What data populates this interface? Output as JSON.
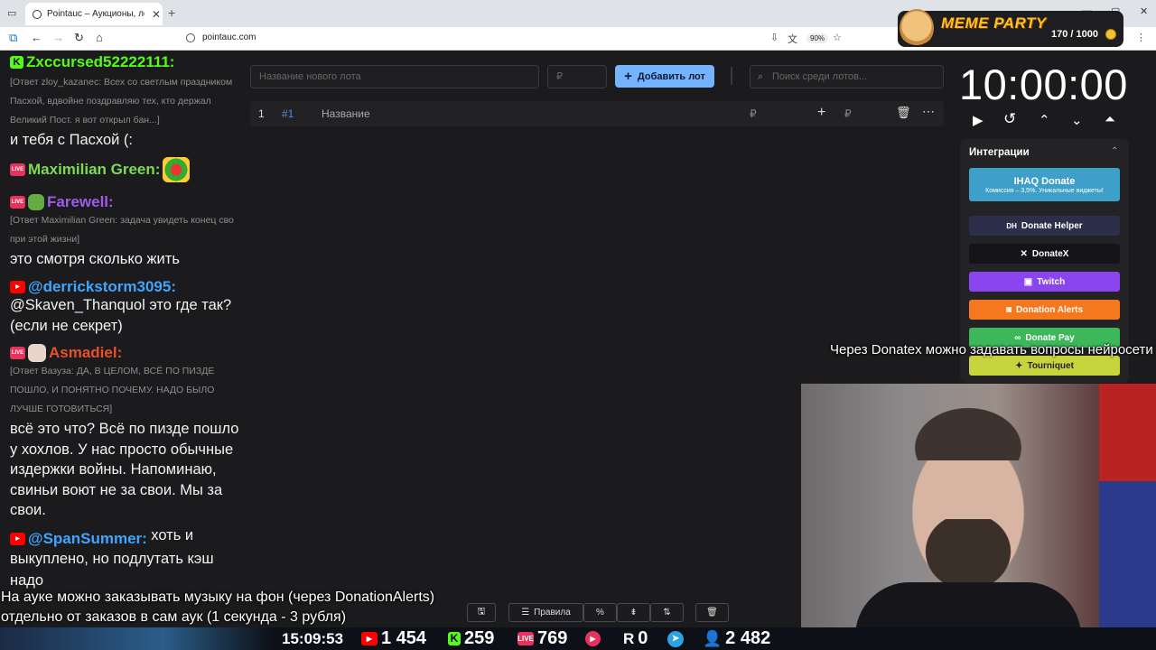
{
  "browser": {
    "tab_title": "Pointauc – Аукционы, лотереи",
    "url": "pointauc.com",
    "zoom": "90%"
  },
  "meme_party": {
    "title": "MEME PARTY",
    "count": "170 / 1000"
  },
  "chat": {
    "messages": [
      {
        "user": "Zxccursed52222111:",
        "user_color": "#53fc18",
        "platform": "kick"
      },
      {
        "reply": "[Ответ zloy_kazanec: Всех со светлым праздником Пасхой, вдвойне поздравляю тех, кто держал Великий Пост. я вот открыл бан...]",
        "text": "и тебя с Пасхой (:"
      },
      {
        "user": "Maximilian Green:",
        "user_color": "#7ed957",
        "platform": "live"
      },
      {
        "user": "Farewell:",
        "user_color": "#a05ce6",
        "platform": "live",
        "reply": "[Ответ Maximilian Green: задача увидеть конец сво при этой жизни]",
        "text": "это смотря сколько жить"
      },
      {
        "user": "@derrickstorm3095:",
        "user_color": "#3ea6ff",
        "platform": "youtube",
        "text": "@Skaven_Thanquol это где так? (если не секрет)"
      },
      {
        "user": "Asmadiel:",
        "user_color": "#e8502a",
        "platform": "live",
        "reply": "[Ответ Вазуза: ДА, В ЦЕЛОМ, ВСЁ ПО ПИЗДЕ ПОШЛО, И ПОНЯТНО ПОЧЕМУ. НАДО БЫЛО ЛУЧШЕ ГОТОВИТЬСЯ]",
        "text": "всё это что? Всё по пизде пошло у хохлов. У нас просто обычные издержки войны. Напоминаю, свиньи воют не за свои. Мы за свои."
      },
      {
        "user": "@SpanSummer:",
        "user_color": "#3ea6ff",
        "platform": "youtube",
        "text": "хоть и выкуплено, но подлутать кэш надо"
      }
    ]
  },
  "auction": {
    "lot_name_placeholder": "Название нового лота",
    "amount_placeholder": "₽",
    "add_button": "Добавить лот",
    "search_placeholder": "Поиск среди лотов...",
    "lot": {
      "index": "1",
      "id": "#1",
      "name": "Название",
      "amount_placeholder": "₽"
    },
    "toolbar": {
      "rules": "Правила"
    }
  },
  "timer": {
    "value": "10:00:00"
  },
  "integrations": {
    "title": "Интеграции",
    "items": [
      {
        "label": "IHAQ Donate",
        "sub": "Комиссия – 3,5%. Уникальные виджеты!",
        "color": "#3ea0c8"
      },
      {
        "label": "Donate Helper",
        "color": "#2b2f4a"
      },
      {
        "label": "DonateX",
        "color": "#141418"
      },
      {
        "label": "Twitch",
        "color": "#8b45f0"
      },
      {
        "label": "Donation Alerts",
        "color": "#f5781e"
      },
      {
        "label": "Donate Pay",
        "color": "#3cb85a"
      },
      {
        "label": "Tourniquet",
        "color": "#c8d43c"
      }
    ]
  },
  "overlays": {
    "donatex_note": "Через Donatex можно задавать вопросы нейросети",
    "music_line1": "На ауке можно заказывать музыку на фон (через DonationAlerts)",
    "music_line2": "отдельно от заказов в сам аук (1 секунда - 3 рубля)"
  },
  "stats": {
    "time": "15:09:53",
    "youtube": "1 454",
    "kick": "259",
    "live": "769",
    "rutube": "0",
    "telegram": "",
    "viewers": "2 482"
  }
}
